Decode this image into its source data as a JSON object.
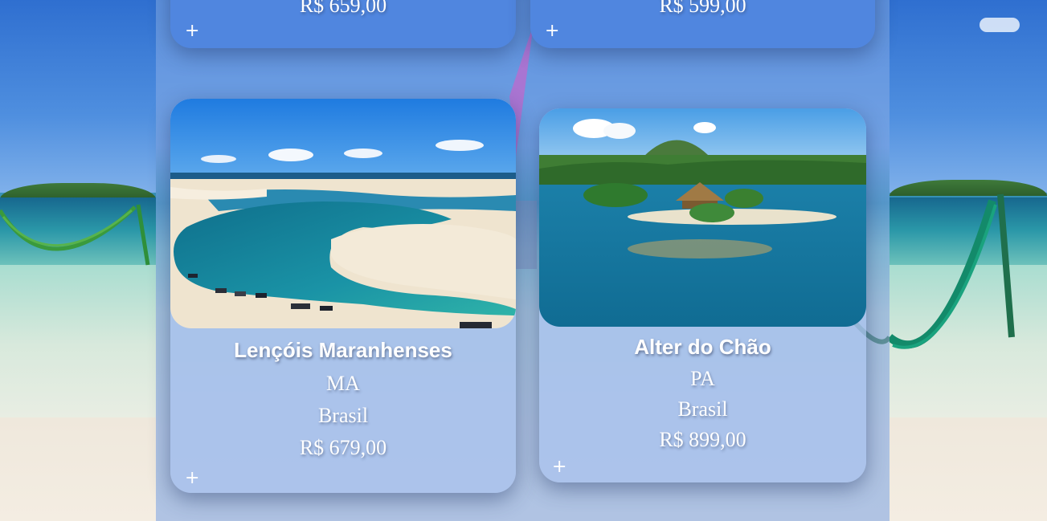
{
  "cards": [
    {
      "name": "",
      "state": "",
      "country": "",
      "price": "R$ 659,00",
      "add_label": "+"
    },
    {
      "name": "",
      "state": "",
      "country": "",
      "price": "R$ 599,00",
      "add_label": "+"
    },
    {
      "name": "Lençóis Maranhenses",
      "state": "MA",
      "country": "Brasil",
      "price": "R$ 679,00",
      "add_label": "+"
    },
    {
      "name": "Alter do Chão",
      "state": "PA",
      "country": "Brasil",
      "price": "R$ 899,00",
      "add_label": "+"
    }
  ],
  "colors": {
    "panel": "#7aa0e1",
    "card_top": "#5086df",
    "text": "#ffffff"
  }
}
